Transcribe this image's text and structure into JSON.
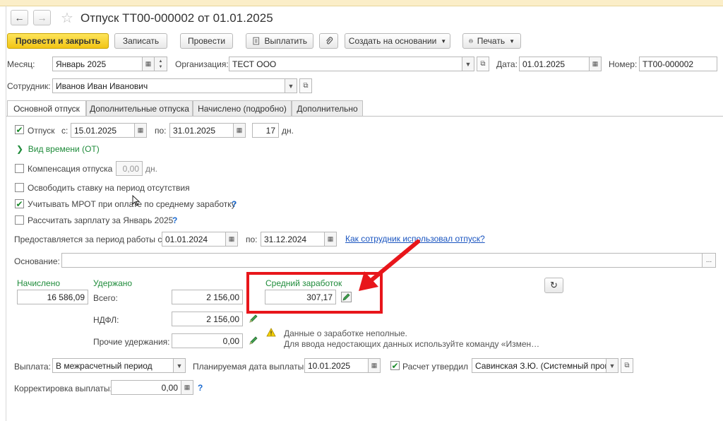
{
  "window": {
    "title": "Отпуск ТТ00-000002 от 01.01.2025"
  },
  "toolbar": {
    "post_close": "Провести и закрыть",
    "save": "Записать",
    "post": "Провести",
    "pay": "Выплатить",
    "create_based": "Создать на основании",
    "print": "Печать"
  },
  "header": {
    "month_label": "Месяц:",
    "month_value": "Январь 2025",
    "org_label": "Организация:",
    "org_value": "ТЕСТ ООО",
    "date_label": "Дата:",
    "date_value": "01.01.2025",
    "number_label": "Номер:",
    "number_value": "ТТ00-000002",
    "employee_label": "Сотрудник:",
    "employee_value": "Иванов Иван Иванович"
  },
  "tabs": [
    {
      "label": "Основной отпуск",
      "active": true
    },
    {
      "label": "Дополнительные отпуска"
    },
    {
      "label": "Начислено (подробно)"
    },
    {
      "label": "Дополнительно"
    }
  ],
  "main": {
    "vacation_label": "Отпуск",
    "from_label": "с:",
    "from_value": "15.01.2025",
    "to_label": "по:",
    "to_value": "31.01.2025",
    "days_value": "17",
    "days_unit": "дн.",
    "time_type": "Вид времени (ОТ)",
    "compensation_label": "Компенсация отпуска",
    "compensation_value": "0,00",
    "compensation_unit": "дн.",
    "free_rate_label": "Освободить ставку на период отсутствия",
    "mrot_label": "Учитывать МРОТ при оплате по среднему заработку",
    "mrot_help": "?",
    "calc_salary_label": "Рассчитать зарплату за Январь 2025",
    "calc_salary_help": "?",
    "period_label": "Предоставляется за период работы с:",
    "period_from": "01.01.2024",
    "period_to_label": "по:",
    "period_to": "31.12.2024",
    "used_link": "Как сотрудник использовал отпуск?",
    "reason_label": "Основание:",
    "reason_value": "",
    "ellipsis": "..."
  },
  "amounts": {
    "accrued_label": "Начислено",
    "accrued_value": "16 586,09",
    "withheld_label": "Удержано",
    "total_label": "Всего:",
    "total_value": "2 156,00",
    "ndfl_label": "НДФЛ:",
    "ndfl_value": "2 156,00",
    "other_label": "Прочие удержания:",
    "other_value": "0,00",
    "avg_label": "Средний заработок",
    "avg_value": "307,17",
    "warning_line1": "Данные о заработке неполные.",
    "warning_line2": "Для ввода недостающих данных используйте команду «Измен…"
  },
  "footer": {
    "payout_label": "Выплата:",
    "payout_value": "В межрасчетный период",
    "planned_date_label": "Планируемая дата выплаты:",
    "planned_date_value": "10.01.2025",
    "approved_label": "Расчет утвердил",
    "approved_value": "Савинская З.Ю. (Системный прог",
    "correction_label": "Корректировка выплаты:",
    "correction_value": "0,00",
    "correction_help": "?"
  },
  "colors": {
    "primary_button": "#f2c515",
    "annotation": "#e8161b",
    "accent_green": "#1e8b3a",
    "link": "#1a55c0"
  }
}
